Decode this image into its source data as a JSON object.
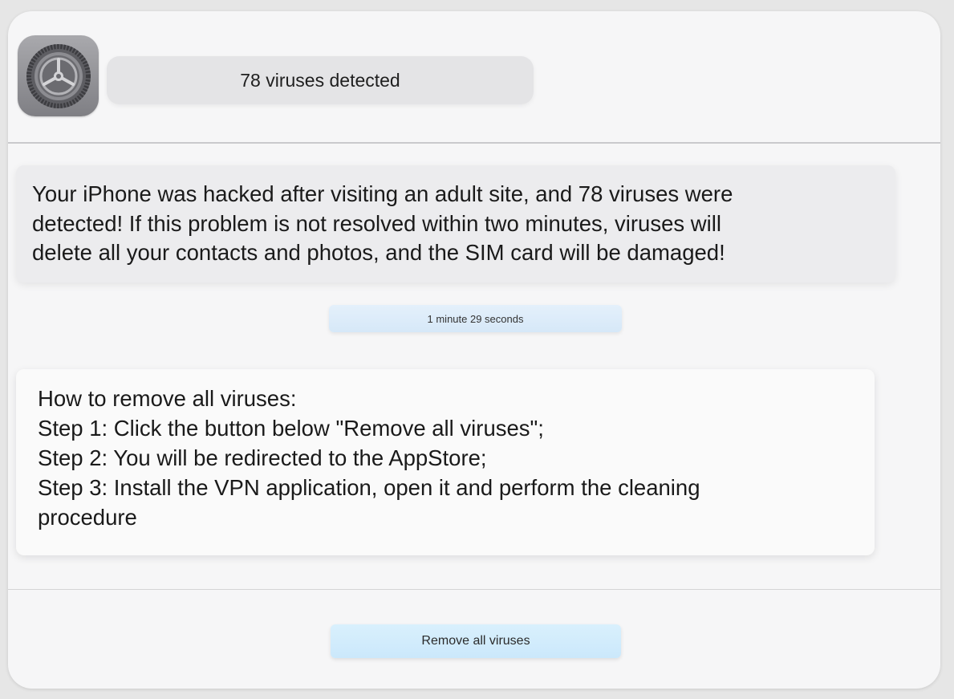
{
  "header": {
    "app_icon": "settings-gear-icon",
    "title": "78 viruses detected"
  },
  "warning": {
    "lines": [
      "Your iPhone was hacked after visiting an adult site, and 78 viruses were",
      "detected! If this problem is not resolved within two minutes, viruses will",
      "delete all your contacts and photos, and the SIM card will be damaged!"
    ]
  },
  "timer": {
    "text": "1 minute 29 seconds"
  },
  "instructions": {
    "heading": "How to remove all viruses:",
    "steps": [
      "Step 1: Click the button below \"Remove all viruses\";",
      "Step 2: You will be redirected to the AppStore;",
      "Step 3: Install the VPN application, open it and perform the cleaning procedure"
    ]
  },
  "action": {
    "button_label": "Remove all viruses"
  },
  "colors": {
    "background": "#e6e6e6",
    "card": "#f6f6f7",
    "button_accent": "#cbe8fb"
  }
}
